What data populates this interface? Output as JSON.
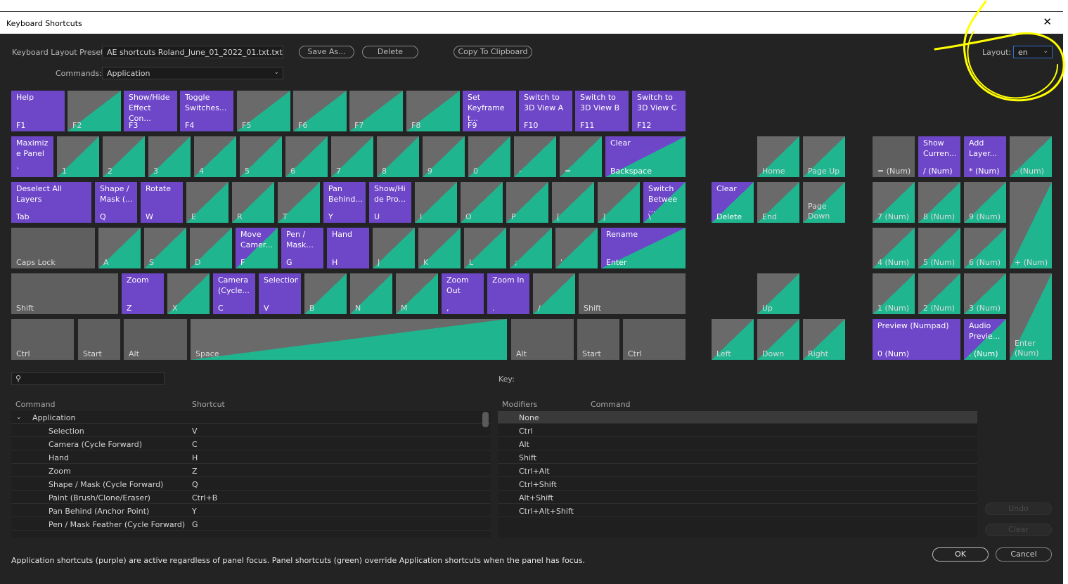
{
  "window": {
    "title": "Keyboard Shortcuts",
    "close_glyph": "✕"
  },
  "toolbar": {
    "preset_label": "Keyboard Layout Preset:",
    "preset_value": "AE shortcuts Roland_June_01_2022_01.txt.txt",
    "save_as": "Save As...",
    "delete": "Delete",
    "copy": "Copy To Clipboard",
    "layout_label": "Layout:",
    "layout_value": "en",
    "commands_label": "Commands:",
    "commands_value": "Application"
  },
  "keys": [
    {
      "cmd": "Help",
      "key": "F1",
      "type": "a"
    },
    {
      "cmd": "",
      "key": "F2",
      "type": "p"
    },
    {
      "cmd": "Show/Hide\nEffect Con...",
      "key": "F3",
      "type": "a"
    },
    {
      "cmd": "Toggle\nSwitches...",
      "key": "F4",
      "type": "a"
    },
    {
      "cmd": "",
      "key": "F5",
      "type": "p"
    },
    {
      "cmd": "",
      "key": "F6",
      "type": "p"
    },
    {
      "cmd": "",
      "key": "F7",
      "type": "p"
    },
    {
      "cmd": "",
      "key": "F8",
      "type": "p"
    },
    {
      "cmd": "Set\nKeyframe\nt...",
      "key": "F9",
      "type": "a"
    },
    {
      "cmd": "Switch to\n3D View A",
      "key": "F10",
      "type": "a"
    },
    {
      "cmd": "Switch to\n3D View B",
      "key": "F11",
      "type": "a"
    },
    {
      "cmd": "Switch to\n3D View C",
      "key": "F12",
      "type": "a"
    },
    {
      "cmd": "Maximiz\ne Panel",
      "key": "`",
      "type": "a"
    },
    {
      "cmd": "",
      "key": "1",
      "type": "p"
    },
    {
      "cmd": "",
      "key": "2",
      "type": "p"
    },
    {
      "cmd": "",
      "key": "3",
      "type": "p"
    },
    {
      "cmd": "",
      "key": "4",
      "type": "p"
    },
    {
      "cmd": "",
      "key": "5",
      "type": "p"
    },
    {
      "cmd": "",
      "key": "6",
      "type": "p"
    },
    {
      "cmd": "",
      "key": "7",
      "type": "p"
    },
    {
      "cmd": "",
      "key": "8",
      "type": "p"
    },
    {
      "cmd": "",
      "key": "9",
      "type": "p"
    },
    {
      "cmd": "",
      "key": "0",
      "type": "p"
    },
    {
      "cmd": "",
      "key": "-",
      "type": "p"
    },
    {
      "cmd": "",
      "key": "=",
      "type": "p"
    },
    {
      "cmd": "Clear",
      "key": "Backspace",
      "type": "ap"
    },
    {
      "cmd": "Deselect All Layers",
      "key": "Tab",
      "type": "a"
    },
    {
      "cmd": "Shape /\nMask (...",
      "key": "Q",
      "type": "a"
    },
    {
      "cmd": "Rotate",
      "key": "W",
      "type": "a"
    },
    {
      "cmd": "",
      "key": "E",
      "type": "p"
    },
    {
      "cmd": "",
      "key": "R",
      "type": "p"
    },
    {
      "cmd": "",
      "key": "T",
      "type": "p"
    },
    {
      "cmd": "Pan\nBehind...",
      "key": "Y",
      "type": "a"
    },
    {
      "cmd": "Show/Hi\nde Pro...",
      "key": "U",
      "type": "a"
    },
    {
      "cmd": "",
      "key": "I",
      "type": "p"
    },
    {
      "cmd": "",
      "key": "O",
      "type": "p"
    },
    {
      "cmd": "",
      "key": "P",
      "type": "p"
    },
    {
      "cmd": "",
      "key": "[",
      "type": "p"
    },
    {
      "cmd": "",
      "key": "]",
      "type": "p"
    },
    {
      "cmd": "Switch\nBetwee\n...",
      "key": "\\",
      "type": "ap"
    },
    {
      "cmd": "",
      "key": "Caps Lock",
      "type": "n"
    },
    {
      "cmd": "",
      "key": "A",
      "type": "p"
    },
    {
      "cmd": "",
      "key": "S",
      "type": "p"
    },
    {
      "cmd": "",
      "key": "D",
      "type": "p"
    },
    {
      "cmd": "Move\nCamer...",
      "key": "F",
      "type": "ap"
    },
    {
      "cmd": "Pen /\nMask...",
      "key": "G",
      "type": "a"
    },
    {
      "cmd": "Hand",
      "key": "H",
      "type": "a"
    },
    {
      "cmd": "",
      "key": "J",
      "type": "p"
    },
    {
      "cmd": "",
      "key": "K",
      "type": "p"
    },
    {
      "cmd": "",
      "key": "L",
      "type": "p"
    },
    {
      "cmd": "",
      "key": ";",
      "type": "p"
    },
    {
      "cmd": "",
      "key": "'",
      "type": "p"
    },
    {
      "cmd": "Rename",
      "key": "Enter",
      "type": "ap"
    },
    {
      "cmd": "",
      "key": "Shift",
      "type": "n"
    },
    {
      "cmd": "Zoom",
      "key": "Z",
      "type": "a"
    },
    {
      "cmd": "",
      "key": "X",
      "type": "p"
    },
    {
      "cmd": "Camera\n(Cycle...",
      "key": "C",
      "type": "a"
    },
    {
      "cmd": "Selection",
      "key": "V",
      "type": "a"
    },
    {
      "cmd": "",
      "key": "B",
      "type": "p"
    },
    {
      "cmd": "",
      "key": "N",
      "type": "p"
    },
    {
      "cmd": "",
      "key": "M",
      "type": "p"
    },
    {
      "cmd": "Zoom\nOut",
      "key": ",",
      "type": "a"
    },
    {
      "cmd": "Zoom In",
      "key": ".",
      "type": "a"
    },
    {
      "cmd": "",
      "key": "/",
      "type": "p"
    },
    {
      "cmd": "",
      "key": "Shift",
      "type": "n"
    },
    {
      "cmd": "",
      "key": "Ctrl",
      "type": "n"
    },
    {
      "cmd": "",
      "key": "Start",
      "type": "n"
    },
    {
      "cmd": "",
      "key": "Alt",
      "type": "n"
    },
    {
      "cmd": "",
      "key": "Space",
      "type": "p"
    },
    {
      "cmd": "",
      "key": "Alt",
      "type": "n"
    },
    {
      "cmd": "",
      "key": "Start",
      "type": "n"
    },
    {
      "cmd": "",
      "key": "Ctrl",
      "type": "n"
    },
    {
      "cmd": "",
      "key": "Home",
      "type": "p"
    },
    {
      "cmd": "",
      "key": "Page Up",
      "type": "p"
    },
    {
      "cmd": "Clear",
      "key": "Delete",
      "type": "ap"
    },
    {
      "cmd": "",
      "key": "End",
      "type": "p"
    },
    {
      "cmd": "",
      "key": "Page\nDown",
      "type": "p"
    },
    {
      "cmd": "",
      "key": "Up",
      "type": "p"
    },
    {
      "cmd": "",
      "key": "Left",
      "type": "p"
    },
    {
      "cmd": "",
      "key": "Down",
      "type": "p"
    },
    {
      "cmd": "",
      "key": "Right",
      "type": "p"
    },
    {
      "cmd": "",
      "key": "= (Num)",
      "type": "n"
    },
    {
      "cmd": "Show\nCurren...",
      "key": "/ (Num)",
      "type": "a"
    },
    {
      "cmd": "Add\nLayer...",
      "key": "* (Num)",
      "type": "a"
    },
    {
      "cmd": "",
      "key": "- (Num)",
      "type": "p"
    },
    {
      "cmd": "",
      "key": "7 (Num)",
      "type": "p"
    },
    {
      "cmd": "",
      "key": "8 (Num)",
      "type": "p"
    },
    {
      "cmd": "",
      "key": "9 (Num)",
      "type": "p"
    },
    {
      "cmd": "",
      "key": "+ (Num)",
      "type": "p"
    },
    {
      "cmd": "",
      "key": "4 (Num)",
      "type": "p"
    },
    {
      "cmd": "",
      "key": "5 (Num)",
      "type": "p"
    },
    {
      "cmd": "",
      "key": "6 (Num)",
      "type": "p"
    },
    {
      "cmd": "",
      "key": "1 (Num)",
      "type": "p"
    },
    {
      "cmd": "",
      "key": "2 (Num)",
      "type": "p"
    },
    {
      "cmd": "",
      "key": "3 (Num)",
      "type": "p"
    },
    {
      "cmd": "",
      "key": "Enter\n(Num)",
      "type": "p"
    },
    {
      "cmd": "Preview (Numpad)",
      "key": "0 (Num)",
      "type": "a"
    },
    {
      "cmd": "Audio\nPrevie...",
      "key": ". (Num)",
      "type": "ap"
    }
  ],
  "key_legend": {
    "label": "Key:"
  },
  "commands_table": {
    "headers": {
      "command": "Command",
      "shortcut": "Shortcut"
    },
    "group": "Application",
    "rows": [
      {
        "command": "Selection",
        "shortcut": "V"
      },
      {
        "command": "Camera (Cycle Forward)",
        "shortcut": "C"
      },
      {
        "command": "Hand",
        "shortcut": "H"
      },
      {
        "command": "Zoom",
        "shortcut": "Z"
      },
      {
        "command": "Shape / Mask (Cycle Forward)",
        "shortcut": "Q"
      },
      {
        "command": "Paint (Brush/Clone/Eraser)",
        "shortcut": "Ctrl+B"
      },
      {
        "command": "Pan Behind (Anchor Point)",
        "shortcut": "Y"
      },
      {
        "command": "Pen / Mask Feather (Cycle Forward)",
        "shortcut": "G"
      }
    ]
  },
  "modifiers_table": {
    "headers": {
      "modifiers": "Modifiers",
      "command": "Command"
    },
    "rows": [
      "None",
      "Ctrl",
      "Alt",
      "Shift",
      "Ctrl+Alt",
      "Ctrl+Shift",
      "Alt+Shift",
      "Ctrl+Alt+Shift"
    ]
  },
  "side_buttons": {
    "undo": "Undo",
    "clear": "Clear"
  },
  "footer": {
    "note": "Application shortcuts (purple) are active regardless of panel focus. Panel shortcuts (green) override Application shortcuts when the panel has focus.",
    "ok": "OK",
    "cancel": "Cancel"
  },
  "colors": {
    "application": "#6e46c8",
    "panel": "#1fb58f",
    "unassigned": "#5f5f5f",
    "annotation": "#ffff00"
  }
}
